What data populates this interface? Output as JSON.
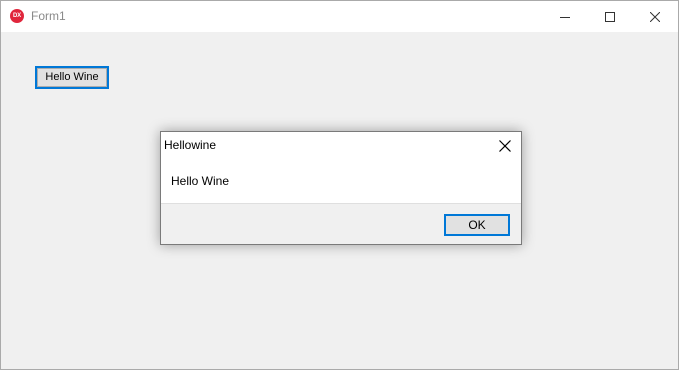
{
  "window": {
    "title": "Form1",
    "app_icon_text": "DX",
    "accent_color": "#0078d7"
  },
  "main": {
    "hello_button_label": "Hello Wine"
  },
  "dialog": {
    "title": "Hellowine",
    "message": "Hello Wine",
    "ok_label": "OK"
  }
}
